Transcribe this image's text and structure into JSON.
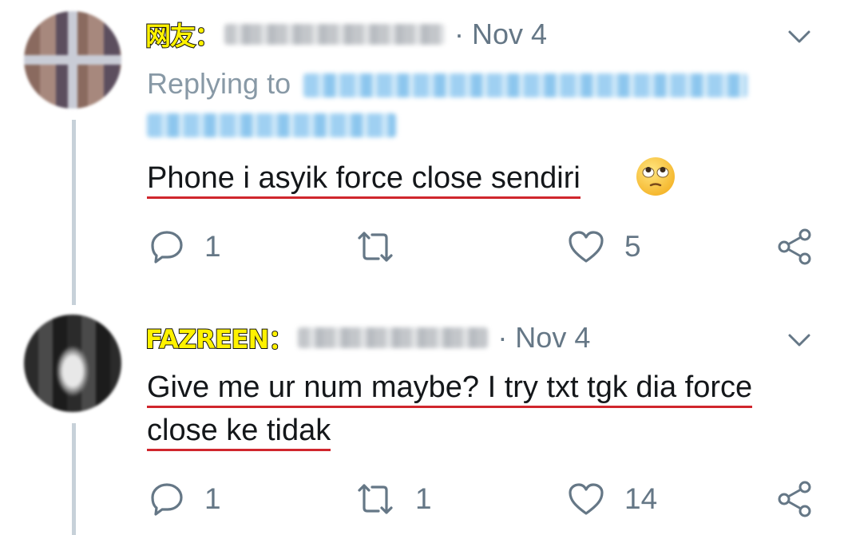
{
  "tweets": [
    {
      "name_label": "网友：",
      "date": "· Nov 4",
      "replying_prefix": "Replying to",
      "text": "Phone i asyik force close sendiri",
      "emoji": "face-with-rolling-eyes-emoji",
      "replies": "1",
      "retweets": "",
      "likes": "5"
    },
    {
      "name_label": "FAZREEN：",
      "date": "· Nov 4",
      "text_line1": "Give me ur num maybe? I try txt tgk dia force",
      "text_line2": "close ke tidak",
      "replies": "1",
      "retweets": "1",
      "likes": "14"
    }
  ],
  "icons": {
    "reply": "reply-icon",
    "retweet": "retweet-icon",
    "like": "heart-icon",
    "share": "share-icon",
    "menu": "chevron-down-icon"
  },
  "colors": {
    "secondary_text": "#657786",
    "thread_line": "#c7d1d9",
    "underline": "#d0262d",
    "name_highlight": "#fff200"
  }
}
